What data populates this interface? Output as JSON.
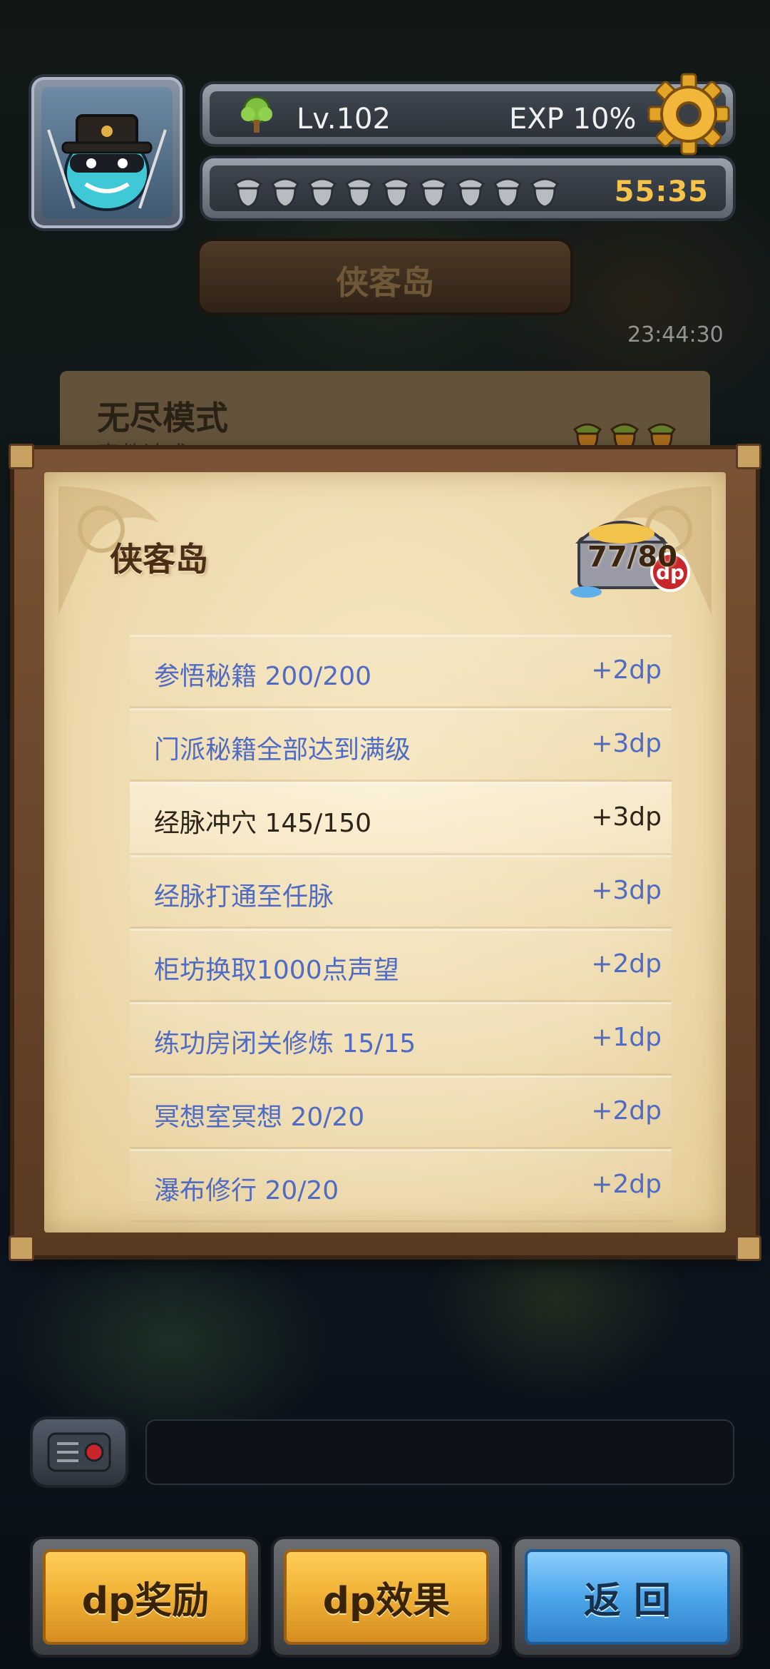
{
  "hud": {
    "level": "Lv.102",
    "exp": "EXP 10%",
    "stamina_count": 9,
    "stamina_timer": "55:35",
    "region_banner": "侠客岛",
    "side_timer": "23:44:30"
  },
  "background_card": {
    "title": "无尽模式",
    "subtitle": "事件读成 77/80"
  },
  "dialog": {
    "title": "侠客岛",
    "dp_count": "77/80",
    "dp_badge": "dp",
    "rows": [
      {
        "label": "参悟秘籍 200/200",
        "reward": "+2dp",
        "completed": true
      },
      {
        "label": "门派秘籍全部达到满级",
        "reward": "+3dp",
        "completed": true
      },
      {
        "label": "经脉冲穴 145/150",
        "reward": "+3dp",
        "completed": false
      },
      {
        "label": "经脉打通至任脉",
        "reward": "+3dp",
        "completed": true
      },
      {
        "label": "柜坊换取1000点声望",
        "reward": "+2dp",
        "completed": true
      },
      {
        "label": "练功房闭关修炼 15/15",
        "reward": "+1dp",
        "completed": true
      },
      {
        "label": "冥想室冥想 20/20",
        "reward": "+2dp",
        "completed": true
      },
      {
        "label": "瀑布修行 20/20",
        "reward": "+2dp",
        "completed": true
      }
    ]
  },
  "buttons": {
    "dp_reward": "dp奖励",
    "dp_effect": "dp效果",
    "back": "返 回"
  },
  "colors": {
    "completed_text": "#4f6bc4",
    "incomplete_text": "#2c2418",
    "timer": "#f7c24a"
  }
}
